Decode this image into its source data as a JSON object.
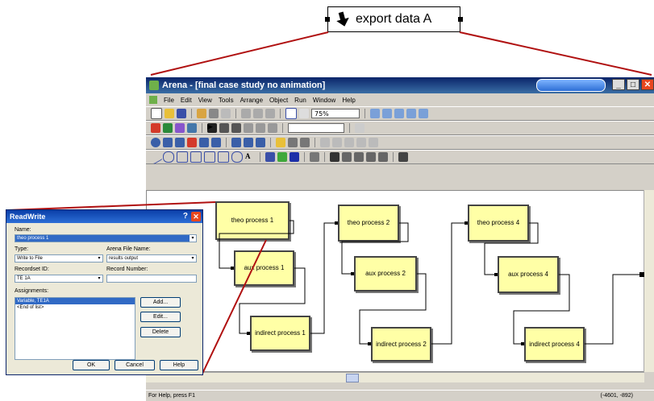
{
  "callout": {
    "label": "export data A"
  },
  "window": {
    "title": "Arena - [final case study no animation]",
    "menu": [
      "File",
      "Edit",
      "View",
      "Tools",
      "Arrange",
      "Object",
      "Run",
      "Window",
      "Help"
    ],
    "zoom": "75%",
    "status_help": "For Help, press F1",
    "status_coords": "(-4601, -892)"
  },
  "blocks": [
    {
      "id": "theo1",
      "label": "theo process 1"
    },
    {
      "id": "aux1",
      "label": "aux process 1"
    },
    {
      "id": "ind1",
      "label": "indirect process 1"
    },
    {
      "id": "theo2",
      "label": "theo process 2"
    },
    {
      "id": "aux2",
      "label": "aux process 2"
    },
    {
      "id": "ind2",
      "label": "indirect process 2"
    },
    {
      "id": "theo4",
      "label": "theo process 4"
    },
    {
      "id": "aux4",
      "label": "aux process 4"
    },
    {
      "id": "ind4",
      "label": "indirect process 4"
    }
  ],
  "dialog": {
    "title": "ReadWrite",
    "name_label": "Name:",
    "name_value": "theo process 1",
    "type_label": "Type:",
    "type_value": "Write to File",
    "file_label": "Arena File Name:",
    "file_value": "results output",
    "recordset_label": "Recordset ID:",
    "recordset_value": "TE 1A",
    "record_label": "Record Number:",
    "record_value": "",
    "assign_label": "Assignments:",
    "assignments": [
      "Variable, TE1A",
      "<End of list>"
    ],
    "add_label": "Add...",
    "edit_label": "Edit...",
    "delete_label": "Delete",
    "ok_label": "OK",
    "cancel_label": "Cancel",
    "help_label": "Help"
  }
}
